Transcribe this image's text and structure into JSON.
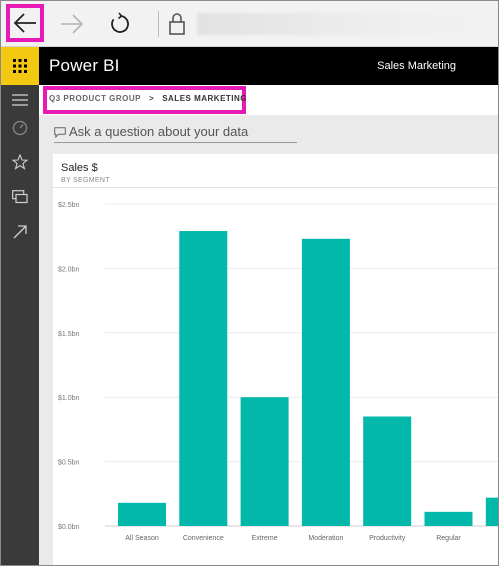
{
  "browser": {
    "icons": [
      "back-arrow-icon",
      "forward-arrow-icon",
      "refresh-icon",
      "lock-icon"
    ],
    "highlight_color": "#e61ab4"
  },
  "app": {
    "title": "Power BI",
    "workspace": "Sales Marketing",
    "launcher_color": "#f2c811"
  },
  "left_nav": {
    "icons": [
      "hamburger-menu-icon",
      "dashboard-gauge-icon",
      "star-icon",
      "workspaces-icon",
      "expand-arrow-icon"
    ]
  },
  "breadcrumb": {
    "parent": "Q3 PRODUCT GROUP",
    "separator": ">",
    "current": "SALES MARKETING"
  },
  "qna": {
    "placeholder": "Ask a question about your data"
  },
  "tile": {
    "title": "Sales $",
    "subtitle": "BY SEGMENT"
  },
  "chart_data": {
    "type": "bar",
    "title": "Sales $",
    "subtitle": "BY SEGMENT",
    "xlabel": "",
    "ylabel": "",
    "categories": [
      "All Season",
      "Convenience",
      "Extreme",
      "Moderation",
      "Productivity",
      "Regular",
      ""
    ],
    "values": [
      0.18,
      2.29,
      1.0,
      2.23,
      0.85,
      0.11,
      0.22
    ],
    "ylim": [
      0,
      2.5
    ],
    "yticks": [
      0,
      0.5,
      1.0,
      1.5,
      2.0,
      2.5
    ],
    "ytick_labels": [
      "$0.0bn",
      "$0.5bn",
      "$1.0bn",
      "$1.5bn",
      "$2.0bn",
      "$2.5bn"
    ],
    "color": "#01b8aa",
    "grid": true
  }
}
